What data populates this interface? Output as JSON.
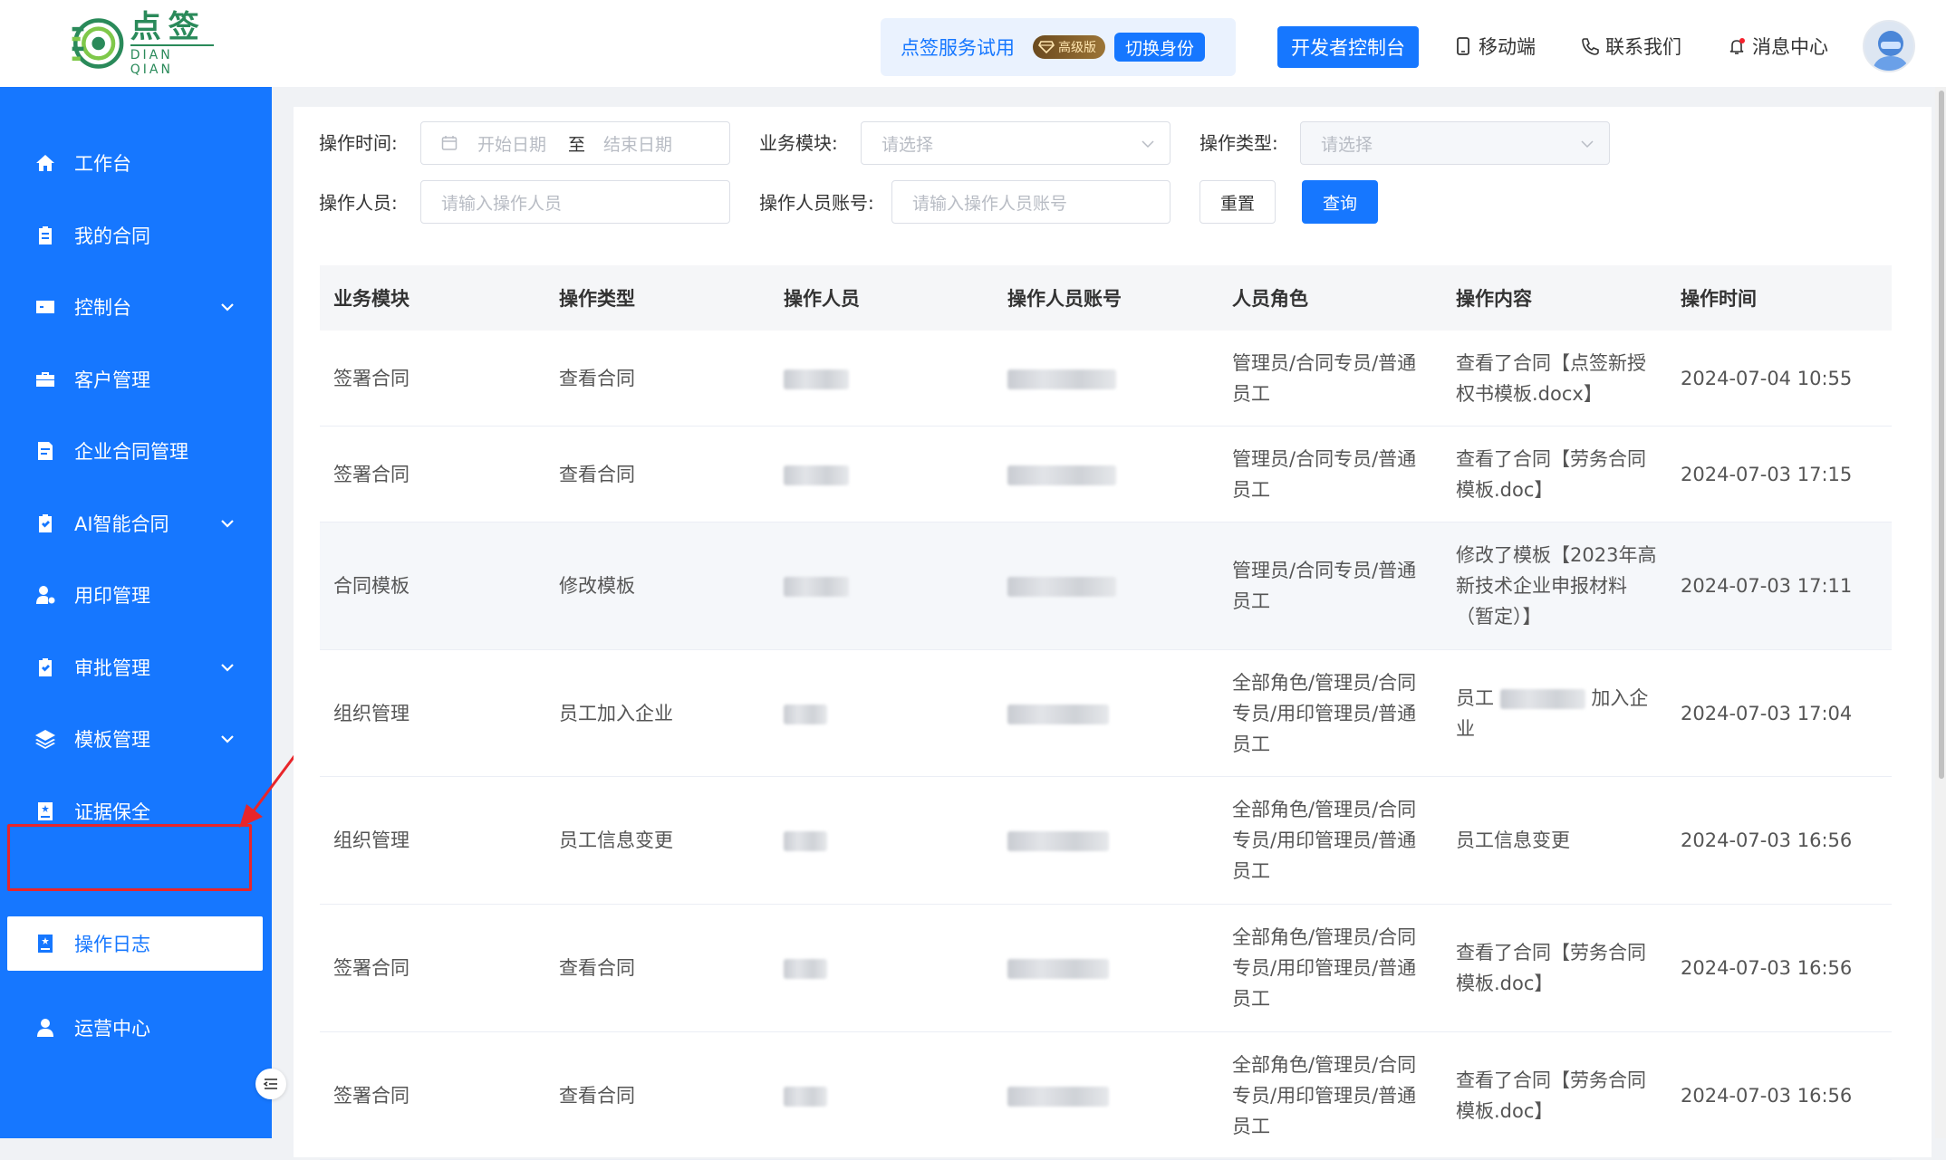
{
  "header": {
    "logo_cn": "点签",
    "logo_en": "DIAN QIAN",
    "trial_text": "点签服务试用",
    "premium_badge": "高级版",
    "switch_identity": "切换身份",
    "dev_console": "开发者控制台",
    "mobile": "移动端",
    "contact": "联系我们",
    "messages": "消息中心"
  },
  "sidebar": {
    "items": [
      {
        "label": "工作台",
        "icon": "home-icon"
      },
      {
        "label": "我的合同",
        "icon": "clipboard-icon"
      },
      {
        "label": "控制台",
        "icon": "console-icon"
      },
      {
        "label": "客户管理",
        "icon": "briefcase-icon"
      },
      {
        "label": "企业合同管理",
        "icon": "document-icon"
      },
      {
        "label": "AI智能合同",
        "icon": "check-clipboard-icon"
      },
      {
        "label": "用印管理",
        "icon": "user-stamp-icon"
      },
      {
        "label": "审批管理",
        "icon": "approve-icon"
      },
      {
        "label": "模板管理",
        "icon": "layers-icon"
      },
      {
        "label": "证据保全",
        "icon": "evidence-icon"
      },
      {
        "label": "操作日志",
        "icon": "log-icon"
      },
      {
        "label": "运营中心",
        "icon": "person-icon"
      }
    ]
  },
  "filters": {
    "time_label": "操作时间:",
    "start_placeholder": "开始日期",
    "to": "至",
    "end_placeholder": "结束日期",
    "module_label": "业务模块:",
    "module_placeholder": "请选择",
    "type_label": "操作类型:",
    "type_placeholder": "请选择",
    "operator_label": "操作人员:",
    "operator_placeholder": "请输入操作人员",
    "account_label": "操作人员账号:",
    "account_placeholder": "请输入操作人员账号",
    "reset": "重置",
    "query": "查询"
  },
  "table": {
    "columns": [
      "业务模块",
      "操作类型",
      "操作人员",
      "操作人员账号",
      "人员角色",
      "操作内容",
      "操作时间"
    ],
    "rows": [
      {
        "module": "签署合同",
        "type": "查看合同",
        "role": "管理员/合同专员/普通员工",
        "content": "查看了合同【点签新授权书模板.docx】",
        "time": "2024-07-04 10:55"
      },
      {
        "module": "签署合同",
        "type": "查看合同",
        "role": "管理员/合同专员/普通员工",
        "content": "查看了合同【劳务合同模板.doc】",
        "time": "2024-07-03 17:15"
      },
      {
        "module": "合同模板",
        "type": "修改模板",
        "role": "管理员/合同专员/普通员工",
        "content": "修改了模板【2023年高新技术企业申报材料（暂定）】",
        "time": "2024-07-03 17:11"
      },
      {
        "module": "组织管理",
        "type": "员工加入企业",
        "role": "全部角色/管理员/合同专员/用印管理员/普通员工",
        "content_pre": "员工",
        "content_post": "加入企业",
        "time": "2024-07-03 17:04"
      },
      {
        "module": "组织管理",
        "type": "员工信息变更",
        "role": "全部角色/管理员/合同专员/用印管理员/普通员工",
        "content": "员工信息变更",
        "time": "2024-07-03 16:56"
      },
      {
        "module": "签署合同",
        "type": "查看合同",
        "role": "全部角色/管理员/合同专员/用印管理员/普通员工",
        "content": "查看了合同【劳务合同模板.doc】",
        "time": "2024-07-03 16:56"
      },
      {
        "module": "签署合同",
        "type": "查看合同",
        "role": "全部角色/管理员/合同专员/用印管理员/普通员工",
        "content": "查看了合同【劳务合同模板.doc】",
        "time": "2024-07-03 16:56"
      }
    ]
  },
  "colors": {
    "primary": "#1677ff",
    "highlight": "#e8252a"
  }
}
